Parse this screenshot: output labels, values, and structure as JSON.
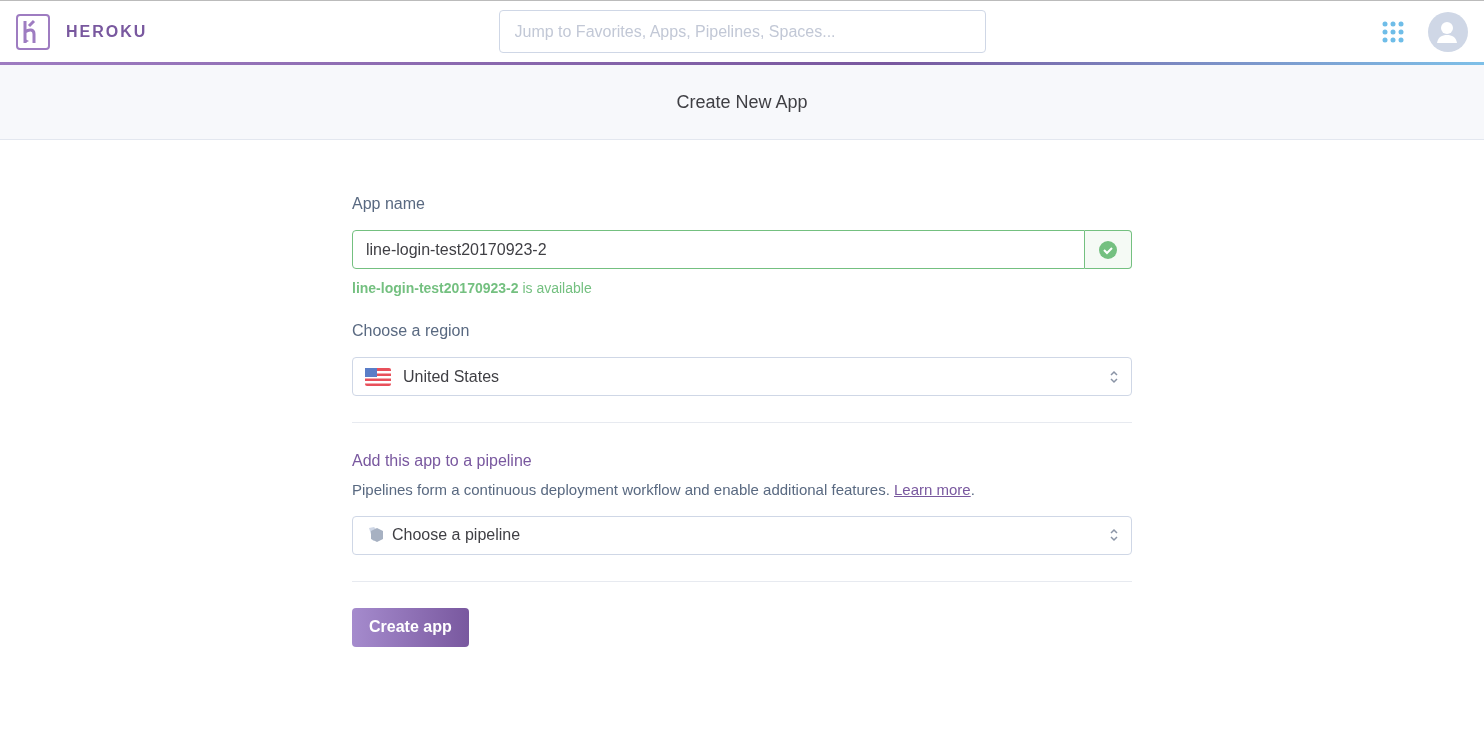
{
  "header": {
    "brand": "HEROKU",
    "search": {
      "placeholder": "Jump to Favorites, Apps, Pipelines, Spaces..."
    }
  },
  "page_title": "Create New App",
  "app_name": {
    "label": "App name",
    "value": "line-login-test20170923-2",
    "valid": true,
    "message": "**line-login-test20170923-2** is available"
  },
  "region": {
    "label": "Choose a region",
    "value": "United States"
  },
  "pipeline": {
    "label": "Add this app to a pipeline",
    "description": "Pipelines form a continuous deployment workflow and enable additional features.",
    "link": "Learn more",
    "link_suffix": ".",
    "value": "Choose a pipeline"
  },
  "submit": "Create app"
}
